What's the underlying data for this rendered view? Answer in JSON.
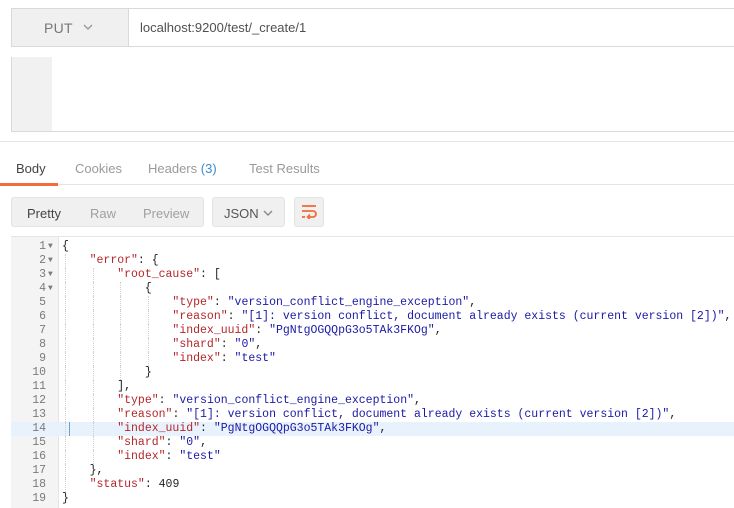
{
  "request": {
    "method": "PUT",
    "url": "localhost:9200/test/_create/1"
  },
  "response_tabs": [
    {
      "label": "Body",
      "active": true
    },
    {
      "label": "Cookies",
      "active": false
    },
    {
      "label": "Headers",
      "count": "(3)",
      "active": false
    },
    {
      "label": "Test Results",
      "active": false
    }
  ],
  "view_modes": [
    "Pretty",
    "Raw",
    "Preview"
  ],
  "active_view": "Pretty",
  "format": "JSON",
  "accent_color": "#f26b3a",
  "highlighted_line": 14,
  "code_lines": [
    {
      "n": "1",
      "fold": true,
      "indent": 0,
      "parts": [
        [
          "p",
          "{"
        ]
      ]
    },
    {
      "n": "2",
      "fold": true,
      "indent": 1,
      "parts": [
        [
          "k",
          "\"error\""
        ],
        [
          "p",
          ": {"
        ]
      ]
    },
    {
      "n": "3",
      "fold": true,
      "indent": 2,
      "parts": [
        [
          "k",
          "\"root_cause\""
        ],
        [
          "p",
          ": ["
        ]
      ]
    },
    {
      "n": "4",
      "fold": true,
      "indent": 3,
      "parts": [
        [
          "p",
          "{"
        ]
      ]
    },
    {
      "n": "5",
      "fold": false,
      "indent": 4,
      "parts": [
        [
          "k",
          "\"type\""
        ],
        [
          "p",
          ": "
        ],
        [
          "s",
          "\"version_conflict_engine_exception\""
        ],
        [
          "p",
          ","
        ]
      ]
    },
    {
      "n": "6",
      "fold": false,
      "indent": 4,
      "parts": [
        [
          "k",
          "\"reason\""
        ],
        [
          "p",
          ": "
        ],
        [
          "s",
          "\"[1]: version conflict, document already exists (current version [2])\""
        ],
        [
          "p",
          ","
        ]
      ]
    },
    {
      "n": "7",
      "fold": false,
      "indent": 4,
      "parts": [
        [
          "k",
          "\"index_uuid\""
        ],
        [
          "p",
          ": "
        ],
        [
          "s",
          "\"PgNtgOGQQpG3o5TAk3FKOg\""
        ],
        [
          "p",
          ","
        ]
      ]
    },
    {
      "n": "8",
      "fold": false,
      "indent": 4,
      "parts": [
        [
          "k",
          "\"shard\""
        ],
        [
          "p",
          ": "
        ],
        [
          "s",
          "\"0\""
        ],
        [
          "p",
          ","
        ]
      ]
    },
    {
      "n": "9",
      "fold": false,
      "indent": 4,
      "parts": [
        [
          "k",
          "\"index\""
        ],
        [
          "p",
          ": "
        ],
        [
          "s",
          "\"test\""
        ]
      ]
    },
    {
      "n": "10",
      "fold": false,
      "indent": 3,
      "parts": [
        [
          "p",
          "}"
        ]
      ]
    },
    {
      "n": "11",
      "fold": false,
      "indent": 2,
      "parts": [
        [
          "p",
          "],"
        ]
      ]
    },
    {
      "n": "12",
      "fold": false,
      "indent": 2,
      "parts": [
        [
          "k",
          "\"type\""
        ],
        [
          "p",
          ": "
        ],
        [
          "s",
          "\"version_conflict_engine_exception\""
        ],
        [
          "p",
          ","
        ]
      ]
    },
    {
      "n": "13",
      "fold": false,
      "indent": 2,
      "parts": [
        [
          "k",
          "\"reason\""
        ],
        [
          "p",
          ": "
        ],
        [
          "s",
          "\"[1]: version conflict, document already exists (current version [2])\""
        ],
        [
          "p",
          ","
        ]
      ]
    },
    {
      "n": "14",
      "fold": false,
      "indent": 2,
      "parts": [
        [
          "k",
          "\"index_uuid\""
        ],
        [
          "p",
          ": "
        ],
        [
          "s",
          "\"PgNtgOGQQpG3o5TAk3FKOg\""
        ],
        [
          "p",
          ","
        ]
      ]
    },
    {
      "n": "15",
      "fold": false,
      "indent": 2,
      "parts": [
        [
          "k",
          "\"shard\""
        ],
        [
          "p",
          ": "
        ],
        [
          "s",
          "\"0\""
        ],
        [
          "p",
          ","
        ]
      ]
    },
    {
      "n": "16",
      "fold": false,
      "indent": 2,
      "parts": [
        [
          "k",
          "\"index\""
        ],
        [
          "p",
          ": "
        ],
        [
          "s",
          "\"test\""
        ]
      ]
    },
    {
      "n": "17",
      "fold": false,
      "indent": 1,
      "parts": [
        [
          "p",
          "},"
        ]
      ]
    },
    {
      "n": "18",
      "fold": false,
      "indent": 1,
      "parts": [
        [
          "k",
          "\"status\""
        ],
        [
          "p",
          ": "
        ],
        [
          "n",
          "409"
        ]
      ]
    },
    {
      "n": "19",
      "fold": false,
      "indent": 0,
      "parts": [
        [
          "p",
          "}"
        ]
      ]
    }
  ]
}
